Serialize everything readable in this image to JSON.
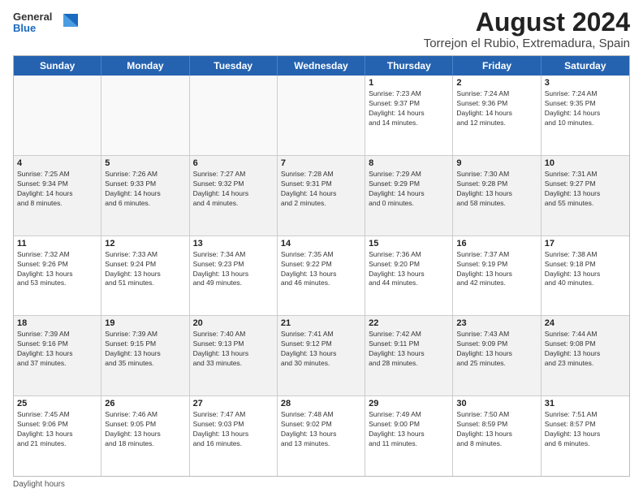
{
  "header": {
    "logo_line1": "General",
    "logo_line2": "Blue",
    "title": "August 2024",
    "subtitle": "Torrejon el Rubio, Extremadura, Spain"
  },
  "days_of_week": [
    "Sunday",
    "Monday",
    "Tuesday",
    "Wednesday",
    "Thursday",
    "Friday",
    "Saturday"
  ],
  "weeks": [
    [
      {
        "day": "",
        "text": "",
        "empty": true
      },
      {
        "day": "",
        "text": "",
        "empty": true
      },
      {
        "day": "",
        "text": "",
        "empty": true
      },
      {
        "day": "",
        "text": "",
        "empty": true
      },
      {
        "day": "1",
        "text": "Sunrise: 7:23 AM\nSunset: 9:37 PM\nDaylight: 14 hours\nand 14 minutes.",
        "empty": false
      },
      {
        "day": "2",
        "text": "Sunrise: 7:24 AM\nSunset: 9:36 PM\nDaylight: 14 hours\nand 12 minutes.",
        "empty": false
      },
      {
        "day": "3",
        "text": "Sunrise: 7:24 AM\nSunset: 9:35 PM\nDaylight: 14 hours\nand 10 minutes.",
        "empty": false
      }
    ],
    [
      {
        "day": "4",
        "text": "Sunrise: 7:25 AM\nSunset: 9:34 PM\nDaylight: 14 hours\nand 8 minutes.",
        "empty": false
      },
      {
        "day": "5",
        "text": "Sunrise: 7:26 AM\nSunset: 9:33 PM\nDaylight: 14 hours\nand 6 minutes.",
        "empty": false
      },
      {
        "day": "6",
        "text": "Sunrise: 7:27 AM\nSunset: 9:32 PM\nDaylight: 14 hours\nand 4 minutes.",
        "empty": false
      },
      {
        "day": "7",
        "text": "Sunrise: 7:28 AM\nSunset: 9:31 PM\nDaylight: 14 hours\nand 2 minutes.",
        "empty": false
      },
      {
        "day": "8",
        "text": "Sunrise: 7:29 AM\nSunset: 9:29 PM\nDaylight: 14 hours\nand 0 minutes.",
        "empty": false
      },
      {
        "day": "9",
        "text": "Sunrise: 7:30 AM\nSunset: 9:28 PM\nDaylight: 13 hours\nand 58 minutes.",
        "empty": false
      },
      {
        "day": "10",
        "text": "Sunrise: 7:31 AM\nSunset: 9:27 PM\nDaylight: 13 hours\nand 55 minutes.",
        "empty": false
      }
    ],
    [
      {
        "day": "11",
        "text": "Sunrise: 7:32 AM\nSunset: 9:26 PM\nDaylight: 13 hours\nand 53 minutes.",
        "empty": false
      },
      {
        "day": "12",
        "text": "Sunrise: 7:33 AM\nSunset: 9:24 PM\nDaylight: 13 hours\nand 51 minutes.",
        "empty": false
      },
      {
        "day": "13",
        "text": "Sunrise: 7:34 AM\nSunset: 9:23 PM\nDaylight: 13 hours\nand 49 minutes.",
        "empty": false
      },
      {
        "day": "14",
        "text": "Sunrise: 7:35 AM\nSunset: 9:22 PM\nDaylight: 13 hours\nand 46 minutes.",
        "empty": false
      },
      {
        "day": "15",
        "text": "Sunrise: 7:36 AM\nSunset: 9:20 PM\nDaylight: 13 hours\nand 44 minutes.",
        "empty": false
      },
      {
        "day": "16",
        "text": "Sunrise: 7:37 AM\nSunset: 9:19 PM\nDaylight: 13 hours\nand 42 minutes.",
        "empty": false
      },
      {
        "day": "17",
        "text": "Sunrise: 7:38 AM\nSunset: 9:18 PM\nDaylight: 13 hours\nand 40 minutes.",
        "empty": false
      }
    ],
    [
      {
        "day": "18",
        "text": "Sunrise: 7:39 AM\nSunset: 9:16 PM\nDaylight: 13 hours\nand 37 minutes.",
        "empty": false
      },
      {
        "day": "19",
        "text": "Sunrise: 7:39 AM\nSunset: 9:15 PM\nDaylight: 13 hours\nand 35 minutes.",
        "empty": false
      },
      {
        "day": "20",
        "text": "Sunrise: 7:40 AM\nSunset: 9:13 PM\nDaylight: 13 hours\nand 33 minutes.",
        "empty": false
      },
      {
        "day": "21",
        "text": "Sunrise: 7:41 AM\nSunset: 9:12 PM\nDaylight: 13 hours\nand 30 minutes.",
        "empty": false
      },
      {
        "day": "22",
        "text": "Sunrise: 7:42 AM\nSunset: 9:11 PM\nDaylight: 13 hours\nand 28 minutes.",
        "empty": false
      },
      {
        "day": "23",
        "text": "Sunrise: 7:43 AM\nSunset: 9:09 PM\nDaylight: 13 hours\nand 25 minutes.",
        "empty": false
      },
      {
        "day": "24",
        "text": "Sunrise: 7:44 AM\nSunset: 9:08 PM\nDaylight: 13 hours\nand 23 minutes.",
        "empty": false
      }
    ],
    [
      {
        "day": "25",
        "text": "Sunrise: 7:45 AM\nSunset: 9:06 PM\nDaylight: 13 hours\nand 21 minutes.",
        "empty": false
      },
      {
        "day": "26",
        "text": "Sunrise: 7:46 AM\nSunset: 9:05 PM\nDaylight: 13 hours\nand 18 minutes.",
        "empty": false
      },
      {
        "day": "27",
        "text": "Sunrise: 7:47 AM\nSunset: 9:03 PM\nDaylight: 13 hours\nand 16 minutes.",
        "empty": false
      },
      {
        "day": "28",
        "text": "Sunrise: 7:48 AM\nSunset: 9:02 PM\nDaylight: 13 hours\nand 13 minutes.",
        "empty": false
      },
      {
        "day": "29",
        "text": "Sunrise: 7:49 AM\nSunset: 9:00 PM\nDaylight: 13 hours\nand 11 minutes.",
        "empty": false
      },
      {
        "day": "30",
        "text": "Sunrise: 7:50 AM\nSunset: 8:59 PM\nDaylight: 13 hours\nand 8 minutes.",
        "empty": false
      },
      {
        "day": "31",
        "text": "Sunrise: 7:51 AM\nSunset: 8:57 PM\nDaylight: 13 hours\nand 6 minutes.",
        "empty": false
      }
    ]
  ],
  "footer": {
    "note": "Daylight hours"
  }
}
